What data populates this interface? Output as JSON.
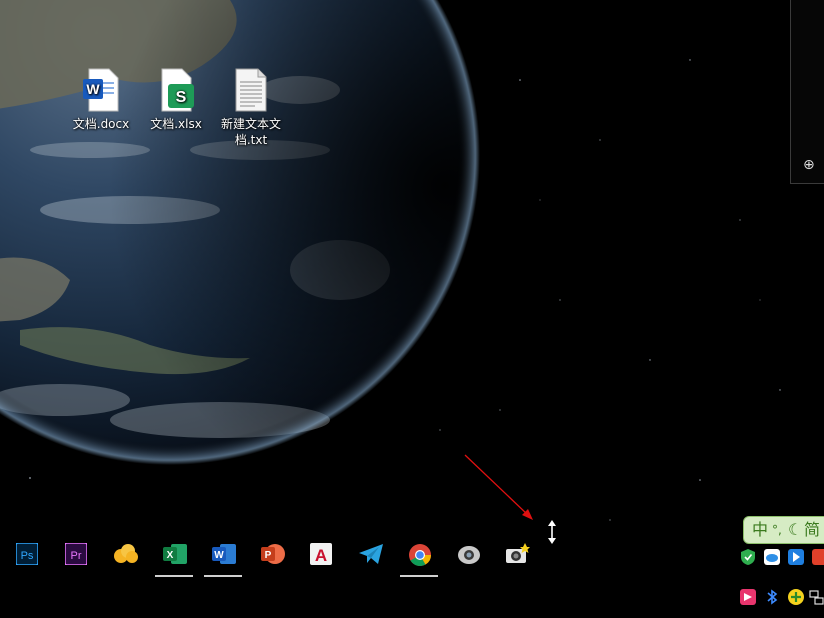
{
  "desktop": {
    "icons": [
      {
        "label": "文档.docx",
        "type": "word",
        "badge": "W",
        "color": "#185abd"
      },
      {
        "label": "文档.xlsx",
        "type": "sheet",
        "badge": "S",
        "color": "#1e9b57"
      },
      {
        "label": "新建文本文档.txt",
        "type": "text",
        "badge": "",
        "color": "#777777"
      }
    ]
  },
  "taskbar": {
    "apps": [
      {
        "name": "photoshop-icon",
        "text": "Ps",
        "color": "#31a8ff",
        "bg": "#001e36",
        "active": false
      },
      {
        "name": "premiere-icon",
        "text": "Pr",
        "color": "#ea77ff",
        "bg": "#2a0a40",
        "active": false
      },
      {
        "name": "cloud-app-icon",
        "text": "",
        "color": "#f5b323",
        "active": false
      },
      {
        "name": "excel-icon",
        "text": "X",
        "color": "#1e9b57",
        "active": true
      },
      {
        "name": "word-icon",
        "text": "W",
        "color": "#185abd",
        "active": true
      },
      {
        "name": "powerpoint-icon",
        "text": "P",
        "color": "#d24726",
        "active": false
      },
      {
        "name": "autocad-icon",
        "text": "A",
        "color": "#c8102e",
        "active": false
      },
      {
        "name": "telegram-icon",
        "text": "",
        "color": "#2aa3e0",
        "active": false
      },
      {
        "name": "chrome-icon",
        "text": "",
        "color": "#4285f4",
        "active": true
      },
      {
        "name": "camera-app-icon",
        "text": "",
        "color": "#bbbbbb",
        "active": false
      },
      {
        "name": "camera-flash-icon",
        "text": "",
        "color": "#dddddd",
        "active": false
      }
    ]
  },
  "ime": {
    "lang": "中",
    "mode": "简"
  },
  "tray": {
    "icons": [
      "shield-tray-icon",
      "cloud-tray-icon",
      "arrow-tray-icon",
      "red-tray-icon",
      "pink-tray-icon",
      "bluetooth-tray-icon",
      "plus-tray-icon",
      "network-tray-icon"
    ]
  },
  "colors": {
    "annotation_arrow": "#e01010",
    "earth_ocean": "#1d3552",
    "earth_glow": "#7aa6cf"
  }
}
